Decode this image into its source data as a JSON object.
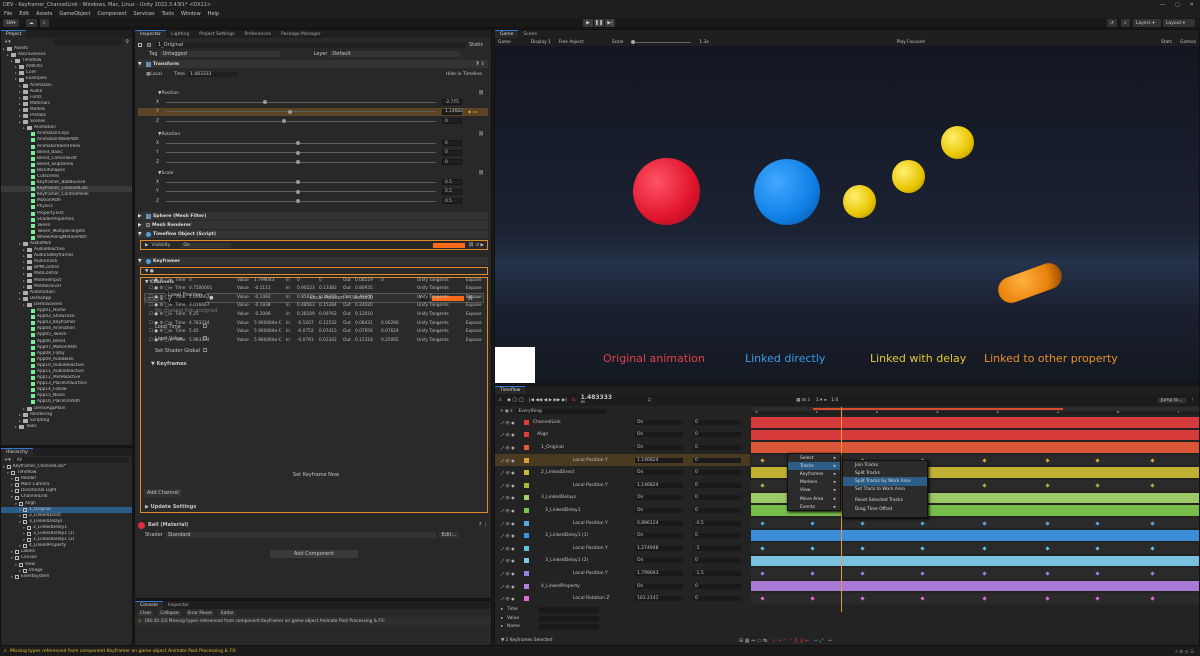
{
  "window": {
    "title": "DEV - Keyframer_ChannelLink - Windows, Mac, Linux - Unity 2022.3.43f1* <DX11>"
  },
  "menu": [
    "File",
    "Edit",
    "Assets",
    "GameObject",
    "Component",
    "Services",
    "Tools",
    "Window",
    "Help"
  ],
  "toolbar": {
    "account": "SW",
    "layers": "Layers",
    "layout": "Layout"
  },
  "project": {
    "tab": "Project",
    "items": [
      "Assets",
      "AsoriGenesis",
      "Timeflow",
      "AddOns",
      "Core",
      "Examples",
      "Animation",
      "Audio",
      "Fonts",
      "Materials",
      "Models",
      "Prefabs",
      "Scenes",
      "Animation",
      "AnimationClips",
      "AnimationWalkPath",
      "AnimatorBlendTrees",
      "Blend_Basic",
      "Blend_CameraEdit",
      "Blend_SkipDemo",
      "BlendShapes",
      "Cutscenes",
      "Keyframer_BallBounce",
      "Keyframer_ChannelLink",
      "Keyframer_ControlPanel",
      "MotionPath",
      "Physics",
      "PropertyTest",
      "ShaderProperties",
      "Tween",
      "Tween_MultipleTargets",
      "WheelAlongMotionPath",
      "AudioMidi",
      "AudioReactive",
      "AudioToKeyframes",
      "AudioTrack",
      "BPMControl",
      "MidiControl",
      "MidiFileInput",
      "MidiReceiver",
      "Automation",
      "DemoApp",
      "DemoScenes",
      "App01_Home",
      "App02_Showcase",
      "App03_Keyframer",
      "App04_Animation",
      "App05_Tween",
      "App06_Blend",
      "App07_MotionPath",
      "App08_Flyby",
      "App09_AutoBank",
      "App10_AudioReactive",
      "App11_AudioReactive",
      "App12_MidiReactive",
      "App13_PlaceOnSurface",
      "App14_Follow",
      "App15_Noise",
      "App16_PlaceOnPath",
      "DemoAppMain",
      "Rendering",
      "Scripting",
      "Tools"
    ]
  },
  "hierarchy": {
    "tab": "Hierarchy",
    "search": "All",
    "items": [
      "Keyframer_ChannelLink*",
      "Timeflow",
      "Reader",
      "Main Camera",
      "Directional Light",
      "ChannelLink",
      "Align",
      "1_Original",
      "2_LinkedDirect",
      "3_LinkedDelays",
      "3_LinkedDelay1",
      "3_LinkedDelay1 (1)",
      "3_LinkedDelay1 (2)",
      "4_LinkedProperty",
      "Labels",
      "Canvas",
      "View",
      "Image",
      "EventSystem"
    ]
  },
  "inspector": {
    "tabs": [
      "Inspector",
      "Lighting",
      "Project Settings",
      "Preferences",
      "Package Manager"
    ],
    "object_name": "1_Original",
    "static": "Static",
    "tag_label": "Tag",
    "tag": "Untagged",
    "layer_label": "Layer",
    "layer": "Default",
    "transform": "Transform",
    "local": "Local",
    "time_label": "Time",
    "time": "1.483333",
    "hide_in_timeline": "Hide in Timeline",
    "position": "Position",
    "rotation": "Rotation",
    "scale": "Scale",
    "pos_vals": [
      "-2.775",
      "1.14682",
      "0"
    ],
    "rot_vals": [
      "0",
      "0",
      "0"
    ],
    "scale_vals": [
      "0.5",
      "0.5",
      "0.5"
    ],
    "axes": [
      "X",
      "Y",
      "Z"
    ],
    "sphere": "Sphere (Mesh Filter)",
    "mesh": "Mesh Renderer",
    "timeflow_obj": "Timeflow Object (Script)",
    "visibility": "Visibility",
    "visibility_val": "On",
    "keyframer": "Keyframer",
    "channels": "Channels",
    "channel_name": "Local Position Y",
    "channel_type": "Local Position Y (Vector3)",
    "channel_mode": "Y",
    "no_channel": "No channel link assigned",
    "loop_time": "Loop Time",
    "limit_value": "Limit Value",
    "set_shader": "Set Shader Global",
    "keyframes": "Keyframes",
    "keyframe_rows": [
      [
        "0",
        "1.799043",
        "0",
        "0",
        "0.08519",
        "0"
      ],
      [
        "0.7500001",
        "-0.1111",
        "0.90223",
        "0.13382",
        "0.80935"
      ],
      [
        "1.666667",
        "-0.1492",
        "0.85839",
        "0.18455",
        "0.49606"
      ],
      [
        "3.016667",
        "-0.1938",
        "0.48563",
        "0.15284",
        "0.24020"
      ],
      [
        "4.25",
        "-0.2006",
        "0.28109",
        "0.09762",
        "0.12010"
      ],
      [
        "4.783334",
        "5.960464e-C",
        "-0.1207",
        "0.12532",
        "0.08431",
        "0.06266"
      ],
      [
        "5.45",
        "5.960464e-C",
        "-0.0752",
        "0.07415",
        "0.07656",
        "0.07624"
      ],
      [
        "5.983334",
        "5.960464e-C",
        "-0.0791",
        "0.03342",
        "0.12318",
        "0.25065"
      ]
    ],
    "kf_labels": {
      "time": "Time",
      "value": "Value",
      "in": "In",
      "out": "Out",
      "unify": "Unify Tangents",
      "expose": "Expose"
    },
    "set_keyframe_now": "Set Keyframe Now",
    "add_channel": "Add Channel",
    "update_settings": "Update Settings",
    "material": "Ball (Material)",
    "shader_label": "Shader",
    "shader": "Standard",
    "edit": "Edit...",
    "add_component": "Add Component"
  },
  "console": {
    "tabs": [
      "Console",
      "Inspector"
    ],
    "buttons": [
      "Clear",
      "Collapse",
      "Error Pause",
      "Editor"
    ],
    "message": "[06:42:33] Missing types referenced from component Keyframer on game object Animate Post Processing & FX:"
  },
  "status": {
    "message": "Missing types referenced from component Keyframer on game object Animate Post Processing & FX:"
  },
  "game": {
    "tabs": [
      "Game",
      "Scene"
    ],
    "display_mode": "Game",
    "display": "Display 1",
    "aspect": "Free Aspect",
    "scale_label": "Scale",
    "scale": "1.3x",
    "play_mode": "Play Focused",
    "stats": "Stats",
    "gizmos": "Gizmos",
    "captions": [
      {
        "text": "Original animation",
        "color": "#e0404a"
      },
      {
        "text": "Linked directly",
        "color": "#3a9ae8"
      },
      {
        "text": "Linked with delay",
        "color": "#e6c830"
      },
      {
        "text": "Linked to other property",
        "color": "#e8902a"
      }
    ]
  },
  "timeline": {
    "tab": "Timeflow",
    "time": "1.483333",
    "frame": "89",
    "scale": "1.0",
    "jump": "Jump to...",
    "search": "Everything",
    "ruler": [
      "0",
      "1",
      "2",
      "3",
      "4",
      "5",
      "6",
      "7"
    ],
    "rows": [
      {
        "name": "ChannelLink",
        "value": "On",
        "num": "0",
        "color": "#e23c3c"
      },
      {
        "name": "Align",
        "value": "On",
        "num": "0",
        "color": "#e23c3c"
      },
      {
        "name": "1_Original",
        "value": "On",
        "num": "0",
        "color": "#e45a3a"
      },
      {
        "name": "Local Position Y",
        "value": "1.146824",
        "num": "0",
        "color": "#d9a13e"
      },
      {
        "name": "2_LinkedDirect",
        "value": "On",
        "num": "0",
        "color": "#c9b935"
      },
      {
        "name": "Local Position Y",
        "value": "1.146824",
        "num": "0",
        "color": "#a8b83a"
      },
      {
        "name": "3_LinkedDelays",
        "value": "On",
        "num": "0",
        "color": "#a2d36a"
      },
      {
        "name": "3_LinkedDelay1",
        "value": "On",
        "num": "0",
        "color": "#7bc74c"
      },
      {
        "name": "Local Position Y",
        "value": "0.896124",
        "num": "-0.5",
        "color": "#56a6e2"
      },
      {
        "name": "3_LinkedDelay1 (1)",
        "value": "On",
        "num": "0",
        "color": "#3d94e2"
      },
      {
        "name": "Local Position Y",
        "value": "1.274948",
        "num": "-1",
        "color": "#5cc2e0"
      },
      {
        "name": "3_LinkedDelay1 (2)",
        "value": "On",
        "num": "0",
        "color": "#7fc9ea"
      },
      {
        "name": "Local Position Y",
        "value": "1.799043",
        "num": "-1.5",
        "color": "#9a7ee0"
      },
      {
        "name": "4_LinkedProperty",
        "value": "On",
        "num": "0",
        "color": "#b07fe0"
      },
      {
        "name": "Local Rotation Z",
        "value": "103.2141",
        "num": "0",
        "color": "#e36ad0"
      }
    ],
    "selected_info": "2 Keyframes Selected",
    "footer_fields": [
      "Time",
      "Value",
      "Name"
    ],
    "context_menu": [
      "Select",
      "Tracks",
      "Keyframes",
      "Markers",
      "View",
      "Move Area",
      "Events"
    ],
    "submenu": [
      "Join Tracks",
      "Split Tracks",
      "Split Tracks by Work Area",
      "Set Track to Work Area",
      "Reset Selected Tracks",
      "Drag Time Offset"
    ]
  }
}
